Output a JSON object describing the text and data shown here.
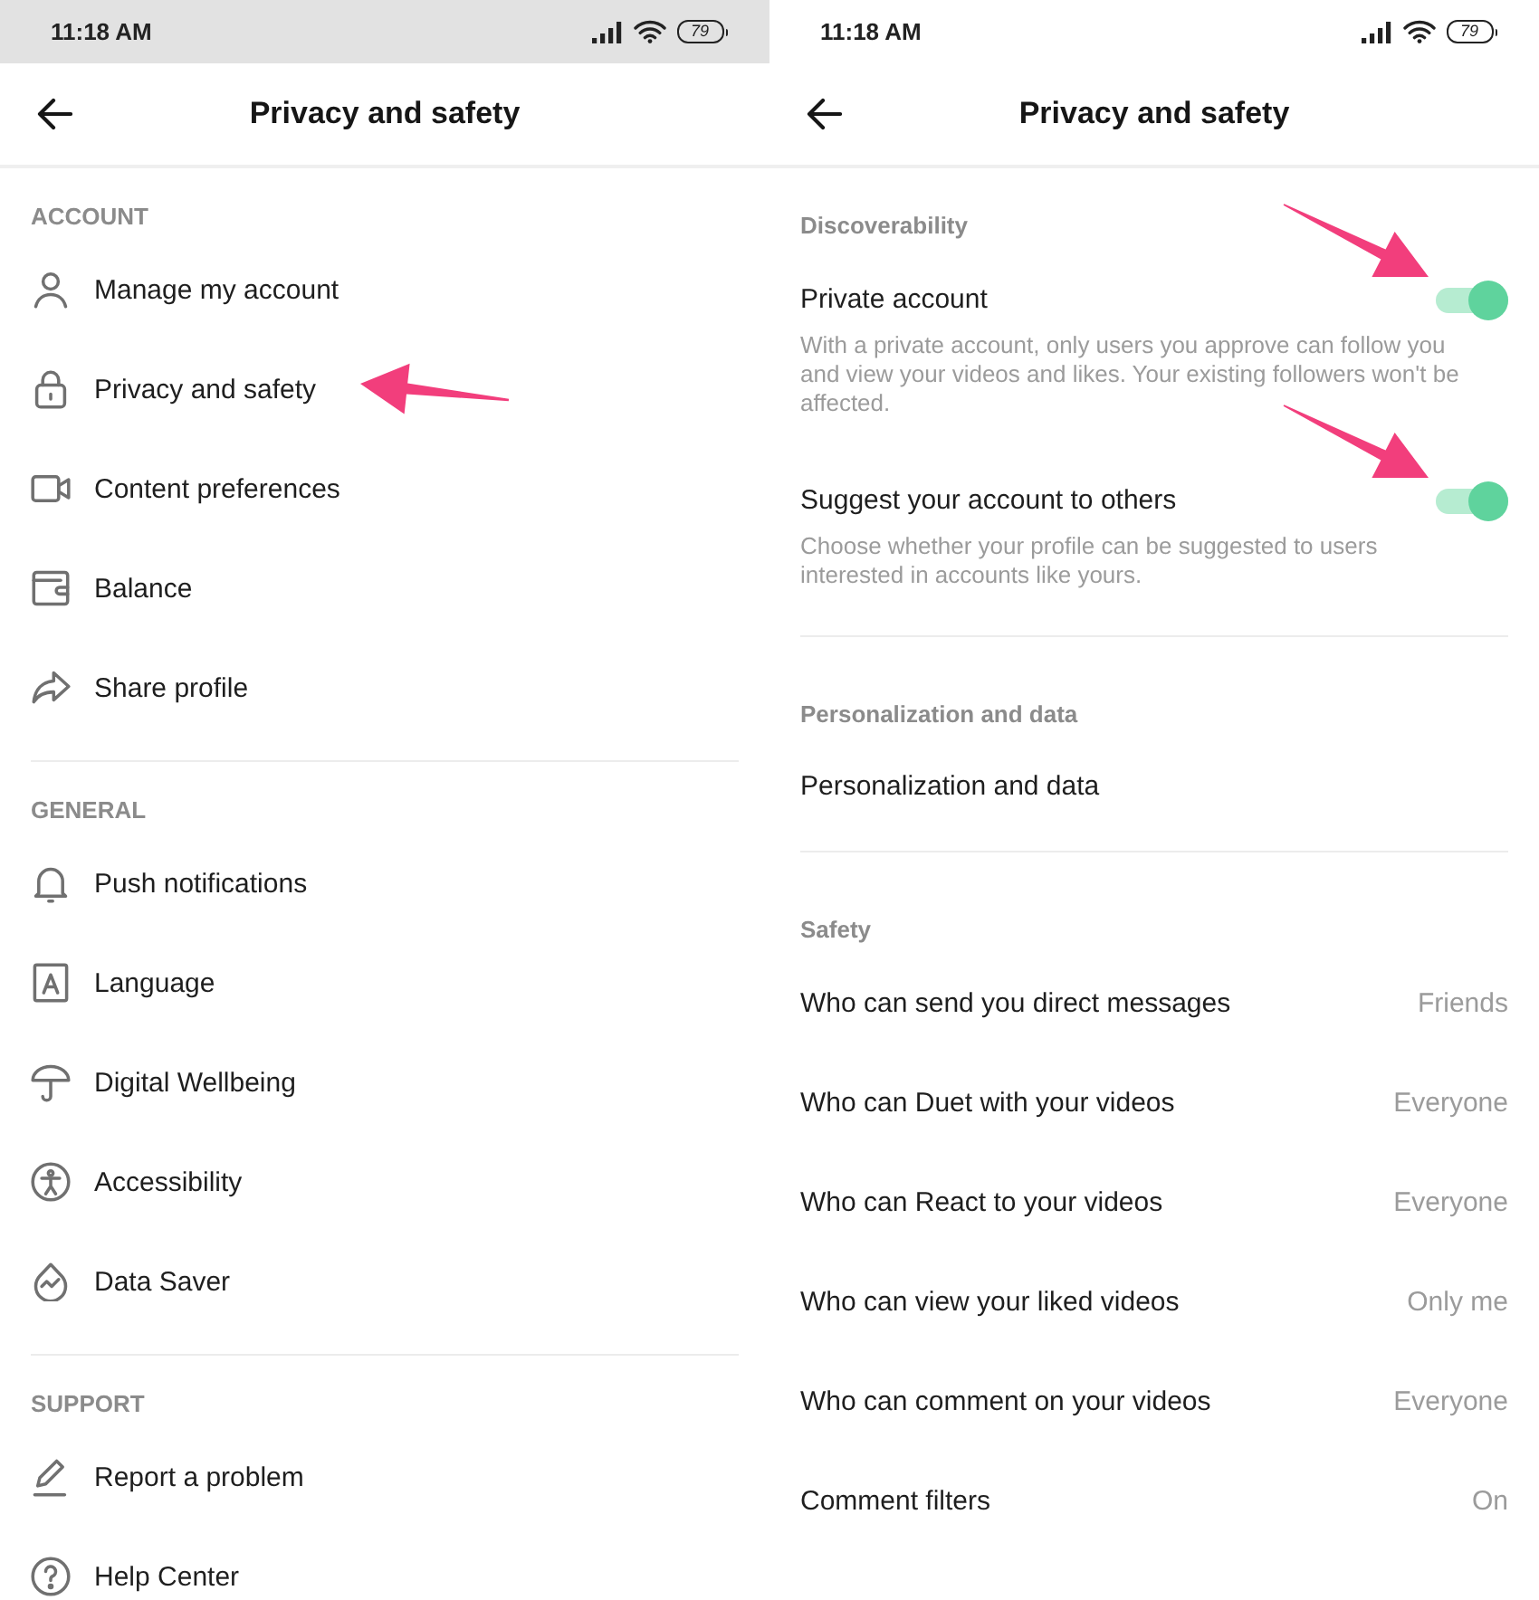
{
  "screens": [
    {
      "status_bar": {
        "time": "11:18 AM",
        "battery": "79"
      },
      "header": {
        "title": "Privacy and safety"
      },
      "sections": [
        {
          "title": "ACCOUNT",
          "items": [
            {
              "kind": "menu",
              "label": "Manage my account",
              "arrow": false
            },
            {
              "kind": "menu",
              "label": "Privacy and safety",
              "arrow": true
            },
            {
              "kind": "menu",
              "label": "Content preferences",
              "arrow": false
            },
            {
              "kind": "menu",
              "label": "Balance",
              "arrow": false
            },
            {
              "kind": "menu",
              "label": "Share profile",
              "arrow": false
            }
          ]
        },
        {
          "title": "GENERAL",
          "items": [
            {
              "kind": "menu",
              "label": "Push notifications",
              "arrow": false
            },
            {
              "kind": "menu",
              "label": "Language",
              "arrow": false
            },
            {
              "kind": "menu",
              "label": "Digital Wellbeing",
              "arrow": false
            },
            {
              "kind": "menu",
              "label": "Accessibility",
              "arrow": false
            },
            {
              "kind": "menu",
              "label": "Data Saver",
              "arrow": false
            }
          ]
        },
        {
          "title": "SUPPORT",
          "items": [
            {
              "kind": "menu",
              "label": "Report a problem",
              "arrow": false
            },
            {
              "kind": "menu",
              "label": "Help Center",
              "arrow": false
            }
          ]
        }
      ]
    },
    {
      "status_bar": {
        "time": "11:18 AM",
        "battery": "79"
      },
      "header": {
        "title": "Privacy and safety"
      },
      "sections": [
        {
          "title": "Discoverability",
          "items": [
            {
              "kind": "toggle",
              "label": "Private account",
              "description": "With a private account, only users you approve can follow you and view your videos and likes. Your existing followers won't be affected.",
              "on": true,
              "arrow": true
            },
            {
              "kind": "toggle",
              "label": "Suggest your account to others",
              "description": "Choose whether your profile can be suggested to users interested in accounts like yours.",
              "on": true,
              "arrow": true
            }
          ]
        },
        {
          "title": "Personalization and data",
          "items": [
            {
              "kind": "link",
              "label": "Personalization and data",
              "arrow": false
            }
          ]
        },
        {
          "title": "Safety",
          "items": [
            {
              "kind": "value",
              "label": "Who can send you direct messages",
              "value": "Friends",
              "arrow": false
            },
            {
              "kind": "value",
              "label": "Who can Duet with your videos",
              "value": "Everyone",
              "arrow": false
            },
            {
              "kind": "value",
              "label": "Who can React to your videos",
              "value": "Everyone",
              "arrow": false
            },
            {
              "kind": "value",
              "label": "Who can view your liked videos",
              "value": "Only me",
              "arrow": false
            },
            {
              "kind": "value",
              "label": "Who can comment on your videos",
              "value": "Everyone",
              "arrow": false
            },
            {
              "kind": "value",
              "label": "Comment filters",
              "value": "On",
              "arrow": false
            }
          ]
        }
      ]
    }
  ]
}
